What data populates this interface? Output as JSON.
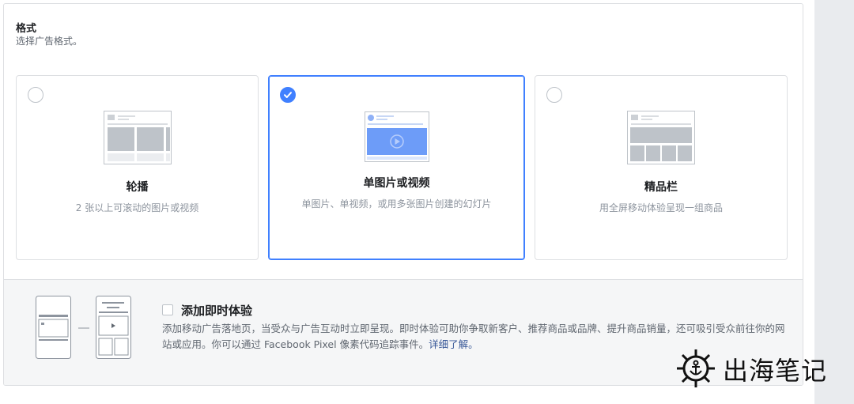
{
  "section": {
    "title": "格式",
    "subtitle": "选择广告格式。"
  },
  "formats": [
    {
      "title": "轮播",
      "description": "2 张以上可滚动的图片或视频",
      "selected": false
    },
    {
      "title": "单图片或视频",
      "description": "单图片、单视频，或用多张图片创建的幻灯片",
      "selected": true
    },
    {
      "title": "精品栏",
      "description": "用全屏移动体验呈现一组商品",
      "selected": false
    }
  ],
  "instant_experience": {
    "checkbox_label": "添加即时体验",
    "description": "添加移动广告落地页，当受众与广告互动时立即呈现。即时体验可助你争取新客户、推荐商品或品牌、提升商品销量，还可吸引受众前往你的网站或应用。你可以通过 Facebook Pixel 像素代码追踪事件。",
    "link_text": "详细了解。",
    "checked": false
  },
  "watermark": {
    "text": "出海笔记",
    "icon": "ship-wheel-anchor-icon"
  },
  "colors": {
    "accent": "#4080ff",
    "link": "#385898",
    "border": "#dddfe2",
    "muted": "#8d949e"
  }
}
